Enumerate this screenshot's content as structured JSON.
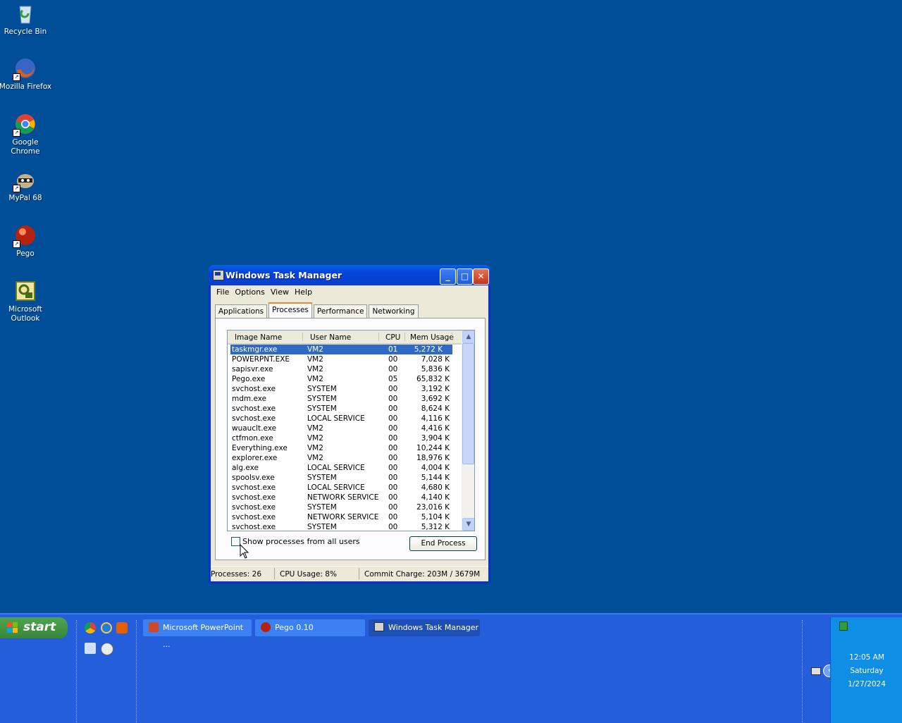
{
  "desktop": {
    "icons": [
      {
        "label": "Recycle Bin"
      },
      {
        "label": "Mozilla Firefox"
      },
      {
        "label": "Google Chrome"
      },
      {
        "label": "MyPal 68"
      },
      {
        "label": "Pego"
      },
      {
        "label": "Microsoft Outlook"
      }
    ]
  },
  "window": {
    "title": "Windows Task Manager",
    "buttons": {
      "minimize": "_",
      "maximize": "□",
      "close": "✕"
    },
    "menu": [
      "File",
      "Options",
      "View",
      "Help"
    ],
    "tabs": [
      "Applications",
      "Processes",
      "Performance",
      "Networking"
    ],
    "active_tab": "Processes",
    "columns": [
      "Image Name",
      "User Name",
      "CPU",
      "Mem Usage"
    ],
    "rows": [
      [
        "taskmgr.exe",
        "VM2",
        "01",
        "5,272 K"
      ],
      [
        "POWERPNT.EXE",
        "VM2",
        "00",
        "7,028 K"
      ],
      [
        "sapisvr.exe",
        "VM2",
        "00",
        "5,836 K"
      ],
      [
        "Pego.exe",
        "VM2",
        "05",
        "65,832 K"
      ],
      [
        "svchost.exe",
        "SYSTEM",
        "00",
        "3,192 K"
      ],
      [
        "mdm.exe",
        "SYSTEM",
        "00",
        "3,692 K"
      ],
      [
        "svchost.exe",
        "SYSTEM",
        "00",
        "8,624 K"
      ],
      [
        "svchost.exe",
        "LOCAL SERVICE",
        "00",
        "4,116 K"
      ],
      [
        "wuauclt.exe",
        "VM2",
        "00",
        "4,416 K"
      ],
      [
        "ctfmon.exe",
        "VM2",
        "00",
        "3,904 K"
      ],
      [
        "Everything.exe",
        "VM2",
        "00",
        "10,244 K"
      ],
      [
        "explorer.exe",
        "VM2",
        "00",
        "18,976 K"
      ],
      [
        "alg.exe",
        "LOCAL SERVICE",
        "00",
        "4,004 K"
      ],
      [
        "spoolsv.exe",
        "SYSTEM",
        "00",
        "5,144 K"
      ],
      [
        "svchost.exe",
        "LOCAL SERVICE",
        "00",
        "4,680 K"
      ],
      [
        "svchost.exe",
        "NETWORK SERVICE",
        "00",
        "4,140 K"
      ],
      [
        "svchost.exe",
        "SYSTEM",
        "00",
        "23,016 K"
      ],
      [
        "svchost.exe",
        "NETWORK SERVICE",
        "00",
        "5,104 K"
      ],
      [
        "svchost.exe",
        "SYSTEM",
        "00",
        "5,312 K"
      ]
    ],
    "selected_row": 0,
    "show_all_label": "Show processes from all users",
    "show_all_checked": false,
    "end_process_label": "End Process",
    "status": {
      "processes": "Processes: 26",
      "cpu": "CPU Usage: 8%",
      "commit": "Commit Charge: 203M / 3679M"
    }
  },
  "taskbar": {
    "start_label": "start",
    "quick_launch": [
      "chrome-icon",
      "ie-icon",
      "firefox-icon",
      "outlook-icon",
      "media-icon"
    ],
    "tasks": [
      {
        "label": "Microsoft PowerPoint ...",
        "icon": "powerpoint-icon"
      },
      {
        "label": "Pego 0.10",
        "icon": "pego-icon"
      },
      {
        "label": "Windows Task Manager",
        "icon": "taskmgr-icon",
        "active": true
      }
    ],
    "clock": {
      "time": "12:05 AM",
      "day": "Saturday",
      "date": "1/27/2024"
    }
  },
  "colors": {
    "desktop": "#004e98",
    "taskbar": "#245edb",
    "selection": "#316ac5",
    "tray": "#0f8ee6"
  }
}
